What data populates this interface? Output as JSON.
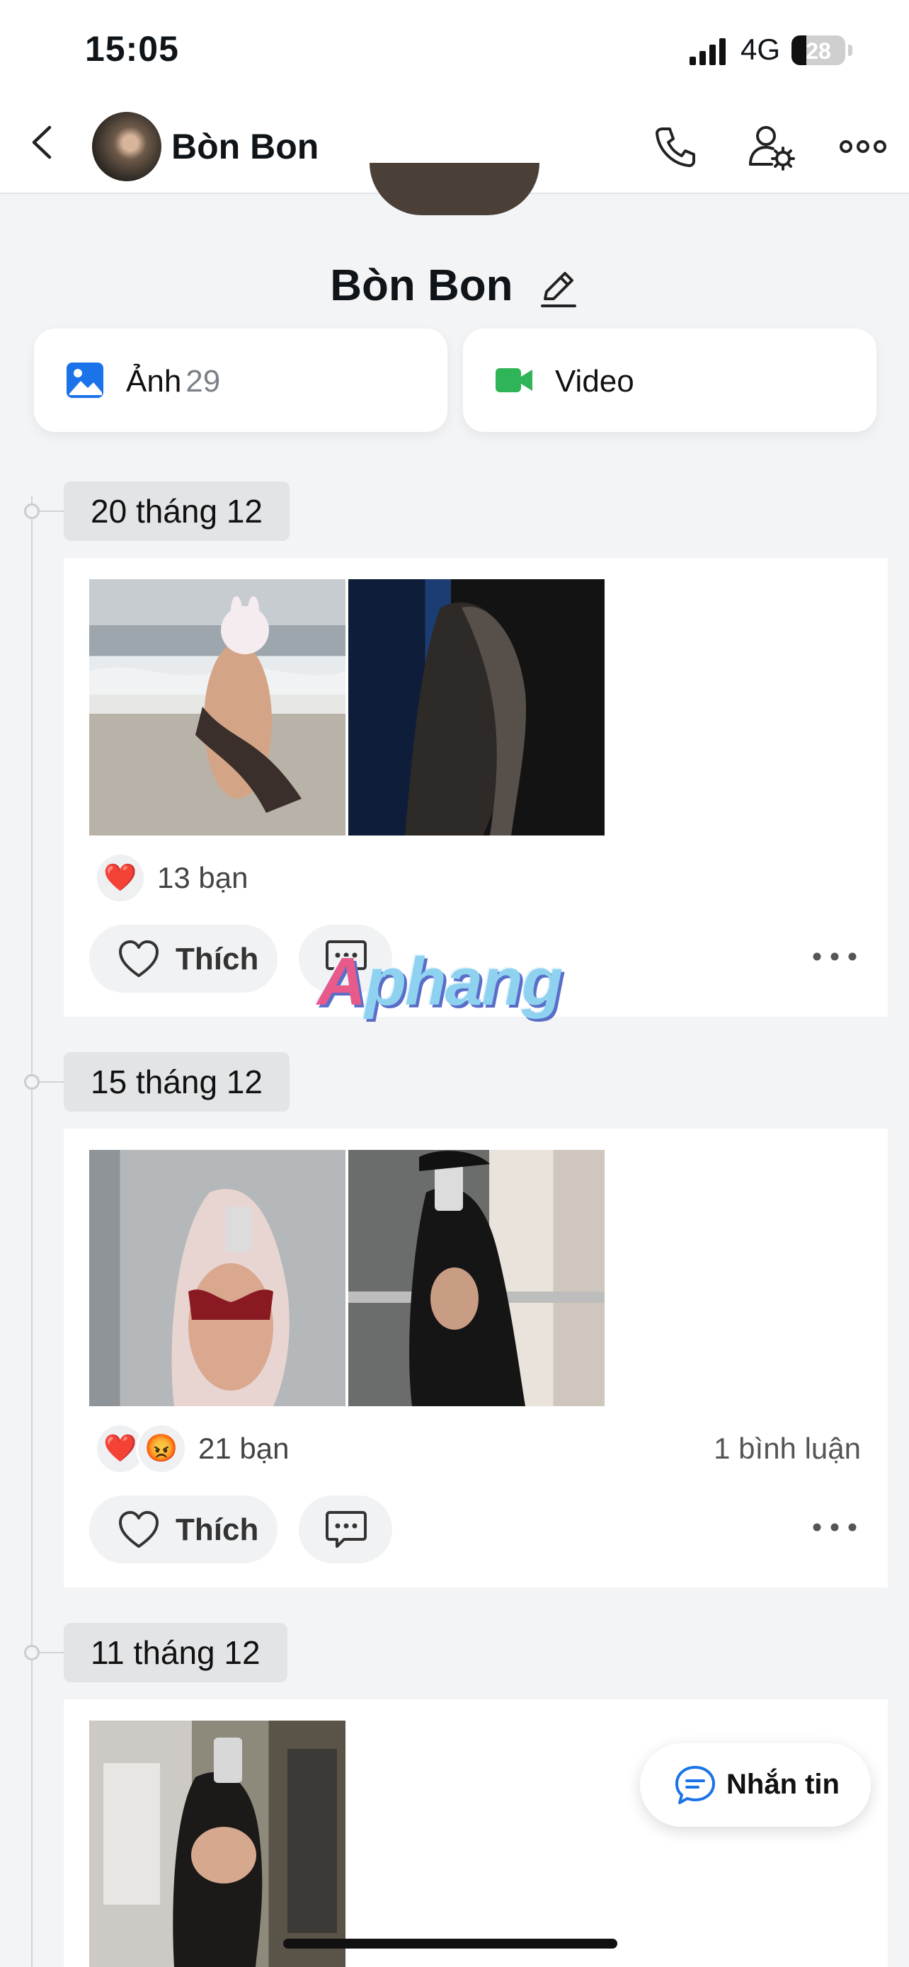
{
  "status_bar": {
    "time": "15:05",
    "network": "4G",
    "battery": "28",
    "battery_level": 0.28
  },
  "header": {
    "title": "Bòn Bon"
  },
  "profile": {
    "name": "Bòn Bon",
    "photos_label": "Ảnh",
    "photos_count": "29",
    "video_label": "Video"
  },
  "posts": [
    {
      "date": "20 tháng 12",
      "reaction_count": "13 bạn",
      "reactions": [
        "❤️"
      ],
      "comments": "",
      "like_label": "Thích"
    },
    {
      "date": "15 tháng 12",
      "reaction_count": "21 bạn",
      "reactions": [
        "❤️",
        "😡"
      ],
      "comments": "1 bình luận",
      "like_label": "Thích"
    },
    {
      "date": "11 tháng 12"
    }
  ],
  "watermark": {
    "first": "A",
    "rest": "phang"
  },
  "chat_fab": {
    "label": "Nhắn tin"
  },
  "colors": {
    "accent_blue": "#1a73e8",
    "video_green": "#2fb457",
    "heart_red": "#e8303b"
  }
}
